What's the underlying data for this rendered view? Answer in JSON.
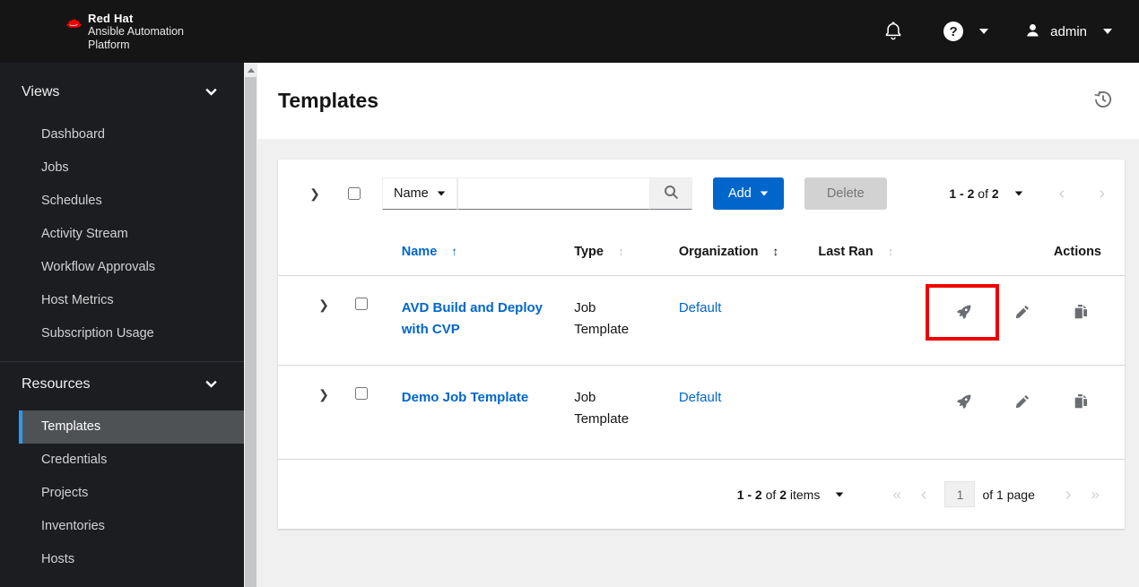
{
  "colors": {
    "accent_blue": "#0066cc",
    "masthead_bg": "#151515",
    "sidebar_bg": "#1b1d21",
    "active_nav_border": "#2b9af3",
    "active_nav_bg": "#4f5255",
    "highlight_red": "#ee0000",
    "icon_gray": "#6a6e73"
  },
  "masthead": {
    "brand_line1": "Red Hat",
    "brand_line2": "Ansible Automation",
    "brand_line3": "Platform",
    "user_label": "admin"
  },
  "sidebar": {
    "sections": [
      {
        "label": "Views",
        "items": [
          "Dashboard",
          "Jobs",
          "Schedules",
          "Activity Stream",
          "Workflow Approvals",
          "Host Metrics",
          "Subscription Usage"
        ]
      },
      {
        "label": "Resources",
        "items": [
          "Templates",
          "Credentials",
          "Projects",
          "Inventories",
          "Hosts"
        ],
        "active_item": "Templates"
      }
    ]
  },
  "page": {
    "title": "Templates"
  },
  "toolbar": {
    "filter_selected": "Name",
    "search_value": "",
    "add_label": "Add",
    "delete_label": "Delete",
    "pagination": {
      "range": "1 - 2",
      "of_word": "of",
      "total": "2"
    }
  },
  "table": {
    "headers": {
      "name": "Name",
      "type": "Type",
      "organization": "Organization",
      "last_ran": "Last Ran",
      "actions": "Actions"
    },
    "rows": [
      {
        "name": "AVD Build and Deploy with CVP",
        "type": "Job Template",
        "organization": "Default",
        "last_ran": ""
      },
      {
        "name": "Demo Job Template",
        "type": "Job Template",
        "organization": "Default",
        "last_ran": ""
      }
    ]
  },
  "pagination_bottom": {
    "range": "1 - 2",
    "of_word": "of",
    "total": "2",
    "items_word": "items",
    "page_value": "1",
    "page_suffix": "of 1 page"
  },
  "icons": {
    "angle_right": "❯",
    "sort_up": "↑",
    "sort_updown": "↕",
    "angle_left_sm": "‹",
    "angle_right_sm": "›",
    "angle_double_left": "«",
    "angle_double_right": "»",
    "help_glyph": "?"
  }
}
